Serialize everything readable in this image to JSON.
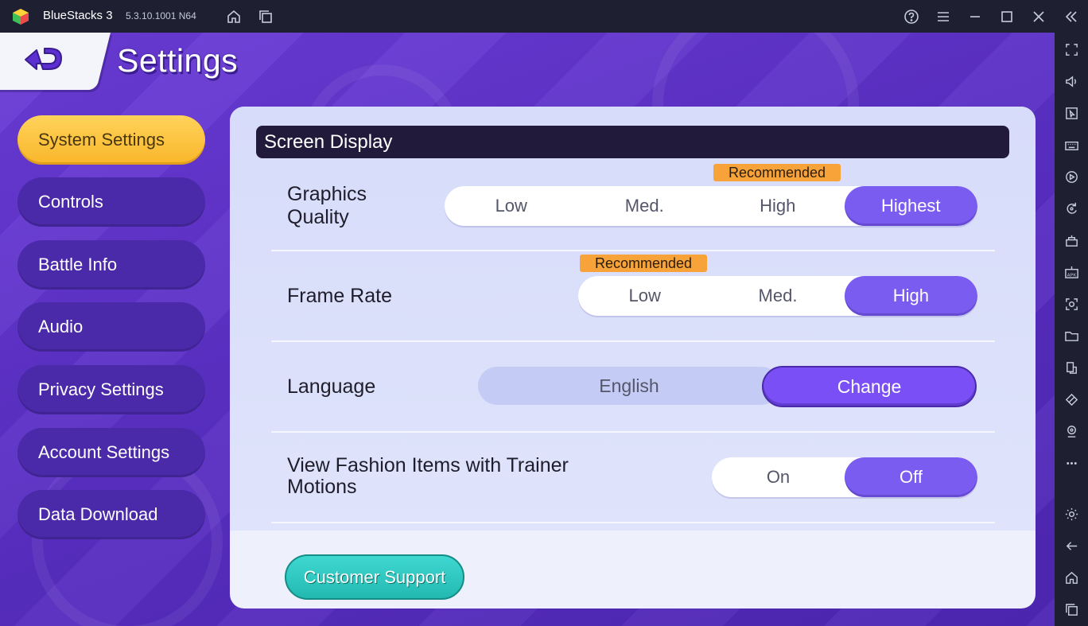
{
  "window": {
    "app_name": "BlueStacks 3",
    "version": "5.3.10.1001 N64",
    "title_icons": [
      "home-icon",
      "multi-instance-icon",
      "help-icon",
      "menu-icon",
      "minimize-icon",
      "maximize-icon",
      "close-icon",
      "collapse-sidebar-icon"
    ]
  },
  "sidebar": {
    "icons": [
      "fullscreen-icon",
      "volume-icon",
      "pointer-icon",
      "keyboard-icon",
      "record-icon",
      "rotate-icon",
      "macro-icon",
      "apk-icon",
      "screenshot-icon",
      "folder-icon",
      "multi-window-icon",
      "eco-mode-icon",
      "location-icon",
      "more-icon",
      "settings-icon",
      "back-icon",
      "home-icon",
      "recent-apps-icon"
    ]
  },
  "header": {
    "title": "Settings"
  },
  "nav": {
    "items": [
      {
        "label": "System Settings",
        "active": true
      },
      {
        "label": "Controls",
        "active": false
      },
      {
        "label": "Battle Info",
        "active": false
      },
      {
        "label": "Audio",
        "active": false
      },
      {
        "label": "Privacy Settings",
        "active": false
      },
      {
        "label": "Account Settings",
        "active": false
      },
      {
        "label": "Data Download",
        "active": false
      }
    ]
  },
  "panel": {
    "section_title": "Screen Display",
    "graphics": {
      "label_line1": "Graphics",
      "label_line2": "Quality",
      "recommended": "Recommended",
      "options": [
        "Low",
        "Med.",
        "High",
        "Highest"
      ],
      "selected": "Highest"
    },
    "frame_rate": {
      "label": "Frame Rate",
      "recommended": "Recommended",
      "options": [
        "Low",
        "Med.",
        "High"
      ],
      "selected": "High"
    },
    "language": {
      "label": "Language",
      "value": "English",
      "change_label": "Change"
    },
    "fashion": {
      "label_line1": "View Fashion Items with Trainer",
      "label_line2": "Motions",
      "options": [
        "On",
        "Off"
      ],
      "selected": "Off"
    },
    "support_label": "Customer Support"
  },
  "colors": {
    "accent_purple": "#7b5cf0",
    "nav_active": "#f9b62a",
    "recommended_badge": "#f8a23a",
    "support_teal": "#22b9b1"
  }
}
